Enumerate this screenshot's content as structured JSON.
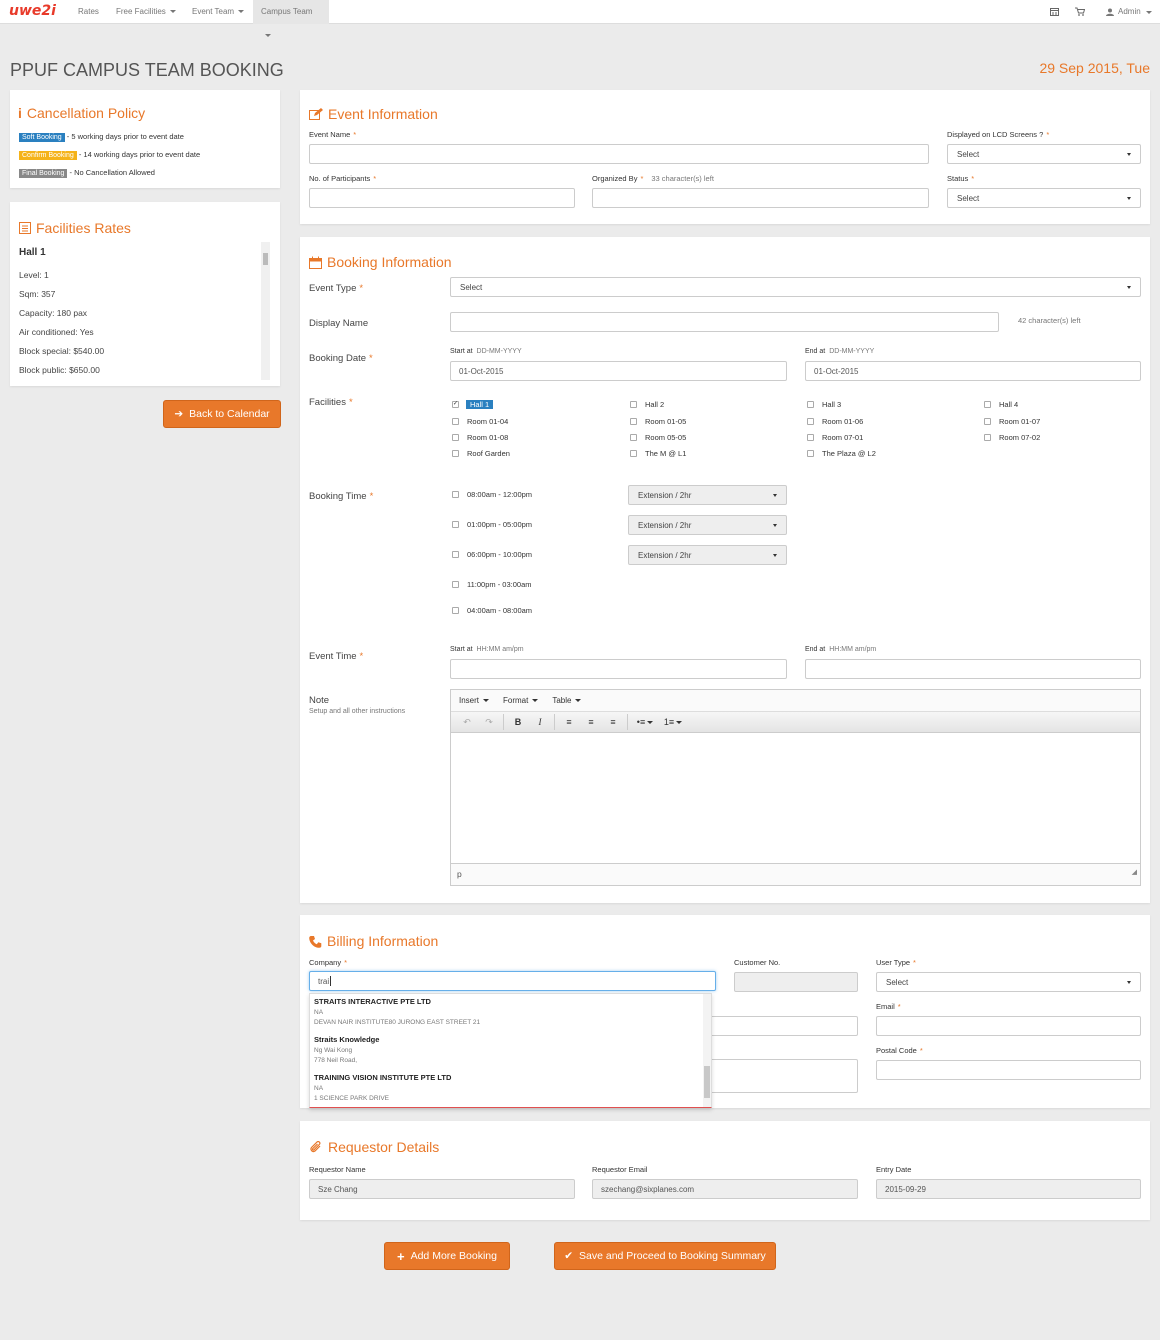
{
  "nav": {
    "logo": "uwe2i",
    "items": [
      "Rates",
      "Free Facilities",
      "Event Team",
      "Campus Team"
    ],
    "admin": "Admin"
  },
  "page": {
    "title": "PPUF CAMPUS TEAM BOOKING",
    "date": "29 Sep 2015, Tue"
  },
  "cancel": {
    "title": "Cancellation Policy",
    "rows": [
      {
        "tag": "Soft Booking",
        "text": "- 5 working days prior to event date",
        "color": "#2a80c0"
      },
      {
        "tag": "Confirm Booking",
        "text": "- 14 working days prior to event date",
        "color": "#f5b31a"
      },
      {
        "tag": "Final Booking",
        "text": "- No Cancellation Allowed",
        "color": "#888888"
      }
    ]
  },
  "rates": {
    "title": "Facilities Rates",
    "hall": "Hall 1",
    "lines": [
      "Level: 1",
      "Sqm: 357",
      "Capacity: 180 pax",
      "Air conditioned: Yes",
      "Block special: $540.00",
      "Block public: $650.00"
    ]
  },
  "back_label": "Back to Calendar",
  "event": {
    "title": "Event Information",
    "name_label": "Event Name",
    "lcd_label": "Displayed on LCD Screens ?",
    "lcd_value": "Select",
    "participants_label": "No. of Participants",
    "organized_label": "Organized By",
    "organized_note": "33 character(s) left",
    "status_label": "Status",
    "status_value": "Select"
  },
  "booking": {
    "title": "Booking Information",
    "type_label": "Event Type",
    "type_value": "Select",
    "display_label": "Display Name",
    "display_note": "42 character(s) left",
    "date_label": "Booking Date",
    "start_label": "Start at",
    "start_fmt": "DD-MM-YYYY",
    "start_value": "01-Oct-2015",
    "end_label": "End at",
    "end_fmt": "DD-MM-YYYY",
    "end_value": "01-Oct-2015",
    "fac_label": "Facilities",
    "facilities": [
      [
        "Hall 1",
        "Hall 2",
        "Hall 3",
        "Hall 4"
      ],
      [
        "Room 01-04",
        "Room 01-05",
        "Room 01-06",
        "Room 01-07"
      ],
      [
        "Room 01-08",
        "Room 05-05",
        "Room 07-01",
        "Room 07-02"
      ],
      [
        "Roof Garden",
        "The M @ L1",
        "The Plaza @ L2",
        ""
      ]
    ],
    "time_label": "Booking Time",
    "slots": [
      "08:00am - 12:00pm",
      "01:00pm - 05:00pm",
      "06:00pm - 10:00pm",
      "11:00pm - 03:00am",
      "04:00am - 08:00am"
    ],
    "extension": "Extension / 2hr",
    "etime_label": "Event Time",
    "etime_start": "Start at",
    "etime_start_fmt": "HH:MM am/pm",
    "etime_end": "End at",
    "etime_end_fmt": "HH:MM am/pm",
    "note_label": "Note",
    "note_sub": "Setup and all other instructions",
    "menus": [
      "Insert",
      "Format",
      "Table"
    ],
    "status_path": "p"
  },
  "billing": {
    "title": "Billing Information",
    "company_label": "Company",
    "company_value": "trai",
    "customer_label": "Customer No.",
    "usertype_label": "User Type",
    "usertype_value": "Select",
    "email_label": "Email",
    "postal_label": "Postal Code",
    "suggestions": [
      {
        "name": "STRAITS INTERACTIVE PTE LTD",
        "l1": "NA",
        "l2": "DEVAN NAIR INSTITUTE80 JURONG EAST STREET 21"
      },
      {
        "name": "Straits Knowledge",
        "l1": "Ng Wai Kong",
        "l2": "778 Neil Road,"
      },
      {
        "name": "TRAINING VISION INSTITUTE PTE LTD",
        "l1": "NA",
        "l2": "1 SCIENCE PARK DRIVE"
      }
    ]
  },
  "requestor": {
    "title": "Requestor Details",
    "name_label": "Requestor Name",
    "name_value": "Sze Chang",
    "email_label": "Requestor Email",
    "email_value": "szechang@sixplanes.com",
    "date_label": "Entry Date",
    "date_value": "2015-09-29"
  },
  "actions": {
    "add": "Add More Booking",
    "save": "Save and Proceed to Booking Summary"
  }
}
